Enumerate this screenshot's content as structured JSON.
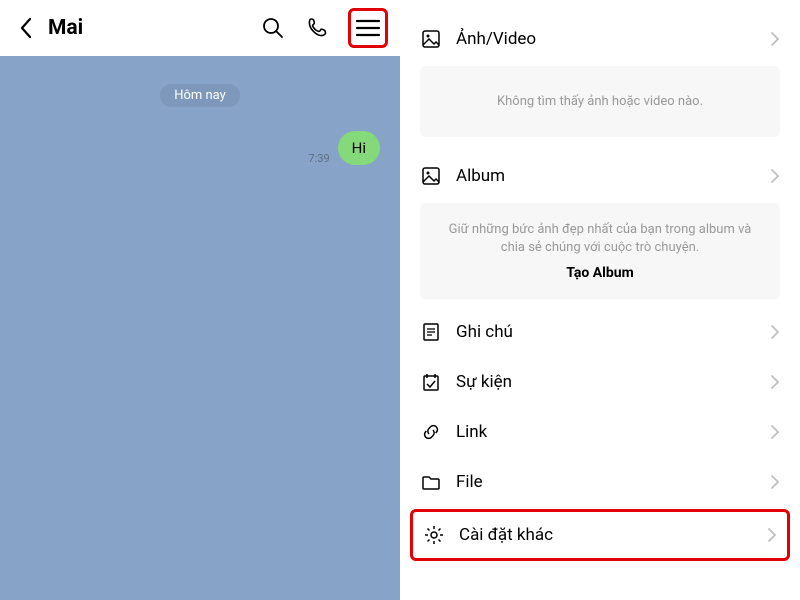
{
  "chat": {
    "contact_name": "Mai",
    "date_label": "Hôm nay",
    "message": {
      "time": "7:39",
      "text": "Hi"
    }
  },
  "panel": {
    "photos": {
      "title": "Ảnh/Video",
      "empty_text": "Không tìm thấy ảnh hoặc video nào."
    },
    "album": {
      "title": "Album",
      "desc_line1": "Giữ những bức ảnh đẹp nhất của bạn trong album và",
      "desc_line2": "chia sẻ chúng với cuộc trò chuyện.",
      "create_label": "Tạo Album"
    },
    "items": {
      "notes": "Ghi chú",
      "events": "Sự kiện",
      "links": "Link",
      "files": "File",
      "settings": "Cài đặt khác"
    }
  }
}
